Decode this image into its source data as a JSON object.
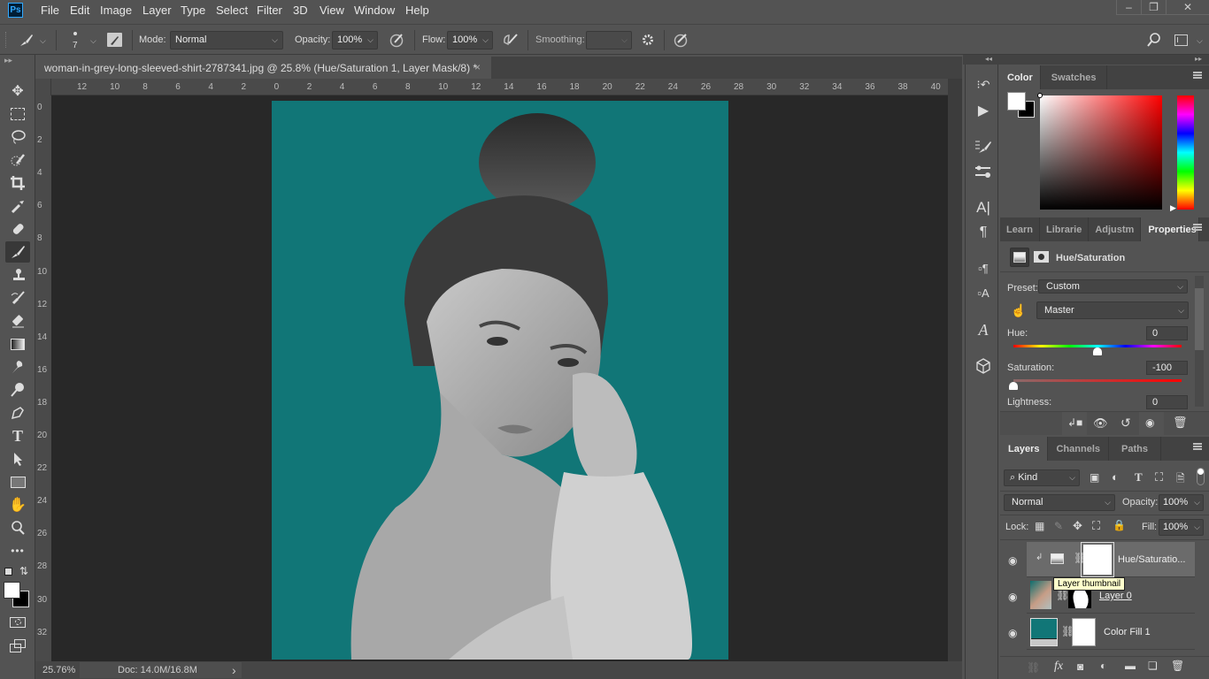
{
  "app": {
    "logo": "Ps"
  },
  "menu": [
    "File",
    "Edit",
    "Image",
    "Layer",
    "Type",
    "Select",
    "Filter",
    "3D",
    "View",
    "Window",
    "Help"
  ],
  "window_controls": {
    "minimize": "–",
    "restore": "❐",
    "close": "✕"
  },
  "options_bar": {
    "brush_size": "7",
    "mode_label": "Mode:",
    "mode_value": "Normal",
    "opacity_label": "Opacity:",
    "opacity_value": "100%",
    "flow_label": "Flow:",
    "flow_value": "100%",
    "smoothing_label": "Smoothing:",
    "smoothing_value": ""
  },
  "document": {
    "tab_title": "woman-in-grey-long-sleeved-shirt-2787341.jpg @ 25.8% (Hue/Saturation 1, Layer Mask/8) *",
    "close": "×",
    "canvas_fill_color": "#117677"
  },
  "rulers": {
    "horizontal": [
      "12",
      "10",
      "8",
      "6",
      "4",
      "2",
      "0",
      "2",
      "4",
      "6",
      "8",
      "10",
      "12",
      "14",
      "16",
      "18",
      "20",
      "22",
      "24",
      "26",
      "28",
      "30",
      "32",
      "34",
      "36",
      "38",
      "40"
    ],
    "vertical": [
      "0",
      "2",
      "4",
      "6",
      "8",
      "10",
      "12",
      "14",
      "16",
      "18",
      "20",
      "22",
      "24",
      "26",
      "28",
      "30",
      "32"
    ]
  },
  "status": {
    "zoom": "25.76%",
    "doc": "Doc: 14.0M/16.8M",
    "arrow": "›"
  },
  "color_panel": {
    "tabs": [
      "Color",
      "Swatches"
    ],
    "active_tab": "Color",
    "foreground": "#ffffff",
    "background": "#000000",
    "hue_color": "#ff0000"
  },
  "properties_panel": {
    "tabs": [
      "Learn",
      "Librarie",
      "Adjustm",
      "Properties"
    ],
    "active_tab": "Properties",
    "title": "Hue/Saturation",
    "preset_label": "Preset:",
    "preset_value": "Custom",
    "channel_value": "Master",
    "hue_label": "Hue:",
    "hue_value": "0",
    "saturation_label": "Saturation:",
    "saturation_value": "-100",
    "lightness_label": "Lightness:",
    "lightness_value": "0",
    "hue_slider_fraction": 0.5,
    "saturation_slider_fraction": 0.0
  },
  "layers_panel": {
    "tabs": [
      "Layers",
      "Channels",
      "Paths"
    ],
    "active_tab": "Layers",
    "filter_value": "Kind",
    "blend_mode": "Normal",
    "opacity_label": "Opacity:",
    "opacity_value": "100%",
    "lock_label": "Lock:",
    "fill_label": "Fill:",
    "fill_value": "100%",
    "layers": [
      {
        "name": "Hue/Saturatio...",
        "type": "adjustment",
        "visible": true,
        "selected": true
      },
      {
        "name": "Layer 0",
        "type": "image",
        "visible": true,
        "selected": false
      },
      {
        "name": "Color Fill 1",
        "type": "fill",
        "visible": true,
        "selected": false,
        "color": "#117677"
      }
    ],
    "tooltip": "Layer thumbnail"
  }
}
